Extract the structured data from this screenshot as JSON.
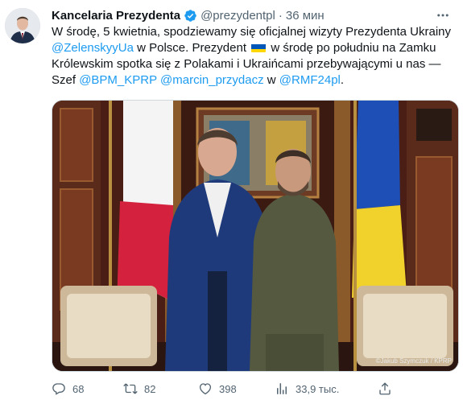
{
  "tweet": {
    "author_name": "Kancelaria Prezydenta",
    "handle": "@prezydentpl",
    "separator": "·",
    "time": "36 мин",
    "text": {
      "p1": "W środę, 5 kwietnia, spodziewamy się oficjalnej wizyty Prezydenta Ukrainy ",
      "mention1": "@ZelenskyyUa",
      "p2": " w Polsce. Prezydent ",
      "p3": " w środę po południu na Zamku Królewskim spotka się z Polakami i Ukraińcami przebywającymi u nas  — Szef ",
      "mention2": "@BPM_KPRP",
      "p4": " ",
      "mention3": "@marcin_przydacz",
      "p5": " w ",
      "mention4": "@RMF24pl",
      "p6": "."
    },
    "photo_credit": "©Jakub Szymczuk / KPRP",
    "stats": {
      "replies": "68",
      "retweets": "82",
      "likes": "398",
      "views": "33,9 тыс."
    }
  },
  "colors": {
    "link": "#1d9bf0",
    "muted": "#536471",
    "text": "#0f1419"
  },
  "icons": [
    "verified-badge-icon",
    "more-icon",
    "reply-icon",
    "retweet-icon",
    "like-icon",
    "views-icon",
    "share-icon"
  ]
}
